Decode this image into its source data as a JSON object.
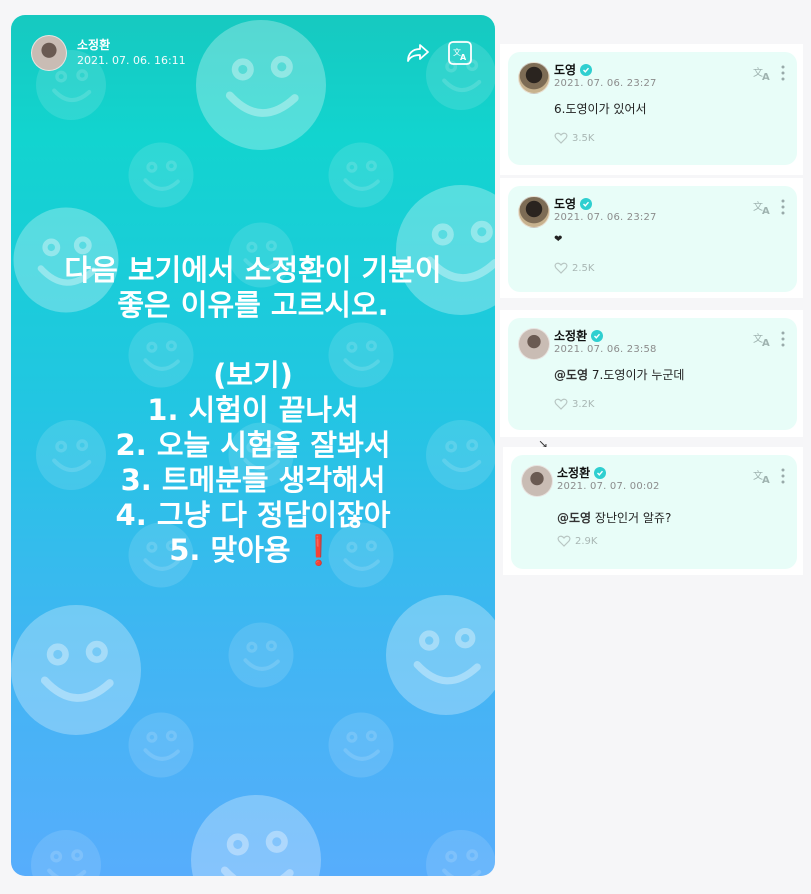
{
  "post": {
    "author": "소정환",
    "date": "2021. 07. 06. 16:11",
    "lines": [
      "다음 보기에서 소정환이 기분이",
      "좋은 이유를 고르시오.",
      "",
      "(보기)",
      "1. 시험이 끝나서",
      "2. 오늘 시험을 잘봐서",
      "3. 트메분들 생각해서",
      "4. 그냥 다 정답이잖아",
      "5. 맞아용"
    ],
    "emoji": "❗",
    "icons": [
      "share-icon",
      "translate-icon"
    ]
  },
  "comments": [
    {
      "author": "도영",
      "date": "2021. 07. 06. 23:27",
      "mention": "",
      "text": "6.도영이가 있어서",
      "likes": "3.5K"
    },
    {
      "author": "도영",
      "date": "2021. 07. 06. 23:27",
      "mention": "",
      "text": "❤",
      "likes": "2.5K"
    },
    {
      "author": "소정환",
      "date": "2021. 07. 06. 23:58",
      "mention": "@도영",
      "text": "7.도영이가 누군데",
      "likes": "3.2K"
    },
    {
      "author": "소정환",
      "date": "2021. 07. 07. 00:02",
      "mention": "@도영",
      "text": "장난인거 알쥬?",
      "likes": "2.9K"
    }
  ],
  "scroll_arrow": "↘",
  "colors": {
    "accent": "#2fcfd0",
    "comment_bg": "#e8fdf8",
    "post_top": "#16c9c0",
    "post_bottom": "#57adfc"
  }
}
